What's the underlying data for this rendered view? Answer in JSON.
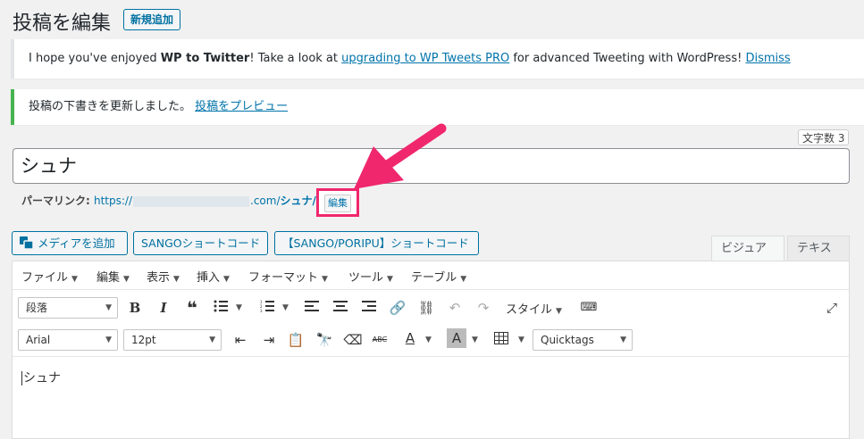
{
  "header": {
    "title": "投稿を編集",
    "add_new_label": "新規追加"
  },
  "notices": {
    "twitter": {
      "prefix": "I hope you've enjoyed ",
      "bold": "WP to Twitter",
      "middle": "! Take a look at ",
      "upgrade_link": "upgrading to WP Tweets PRO",
      "suffix": " for advanced Tweeting with WordPress! ",
      "dismiss_link": "Dismiss"
    },
    "draft": {
      "text": "投稿の下書きを更新しました。 ",
      "preview_link": "投稿をプレビュー"
    }
  },
  "word_count": "文字数 3",
  "title_value": "シュナ",
  "permalink": {
    "label": "パーマリンク: ",
    "prefix": "https://",
    "domain": ".com/",
    "slug": "シュナ/",
    "edit_label": "編集"
  },
  "media_buttons": {
    "add_media": "メディアを追加",
    "sango": "SANGOショートコード",
    "poripu": "【SANGO/PORIPU】ショートコード"
  },
  "tabs": {
    "visual": "ビジュアル",
    "text": "テキスト"
  },
  "menubar": [
    "ファイル",
    "編集",
    "表示",
    "挿入",
    "フォーマット",
    "ツール",
    "テーブル"
  ],
  "toolbar": {
    "format_select": "段落",
    "style_label": "スタイル",
    "font_select": "Arial",
    "size_select": "12pt",
    "quicktags_select": "Quicktags"
  },
  "editor_content": "シュナ",
  "colors": {
    "accent": "#0073aa",
    "highlight": "#f0276d",
    "success": "#46b450"
  }
}
